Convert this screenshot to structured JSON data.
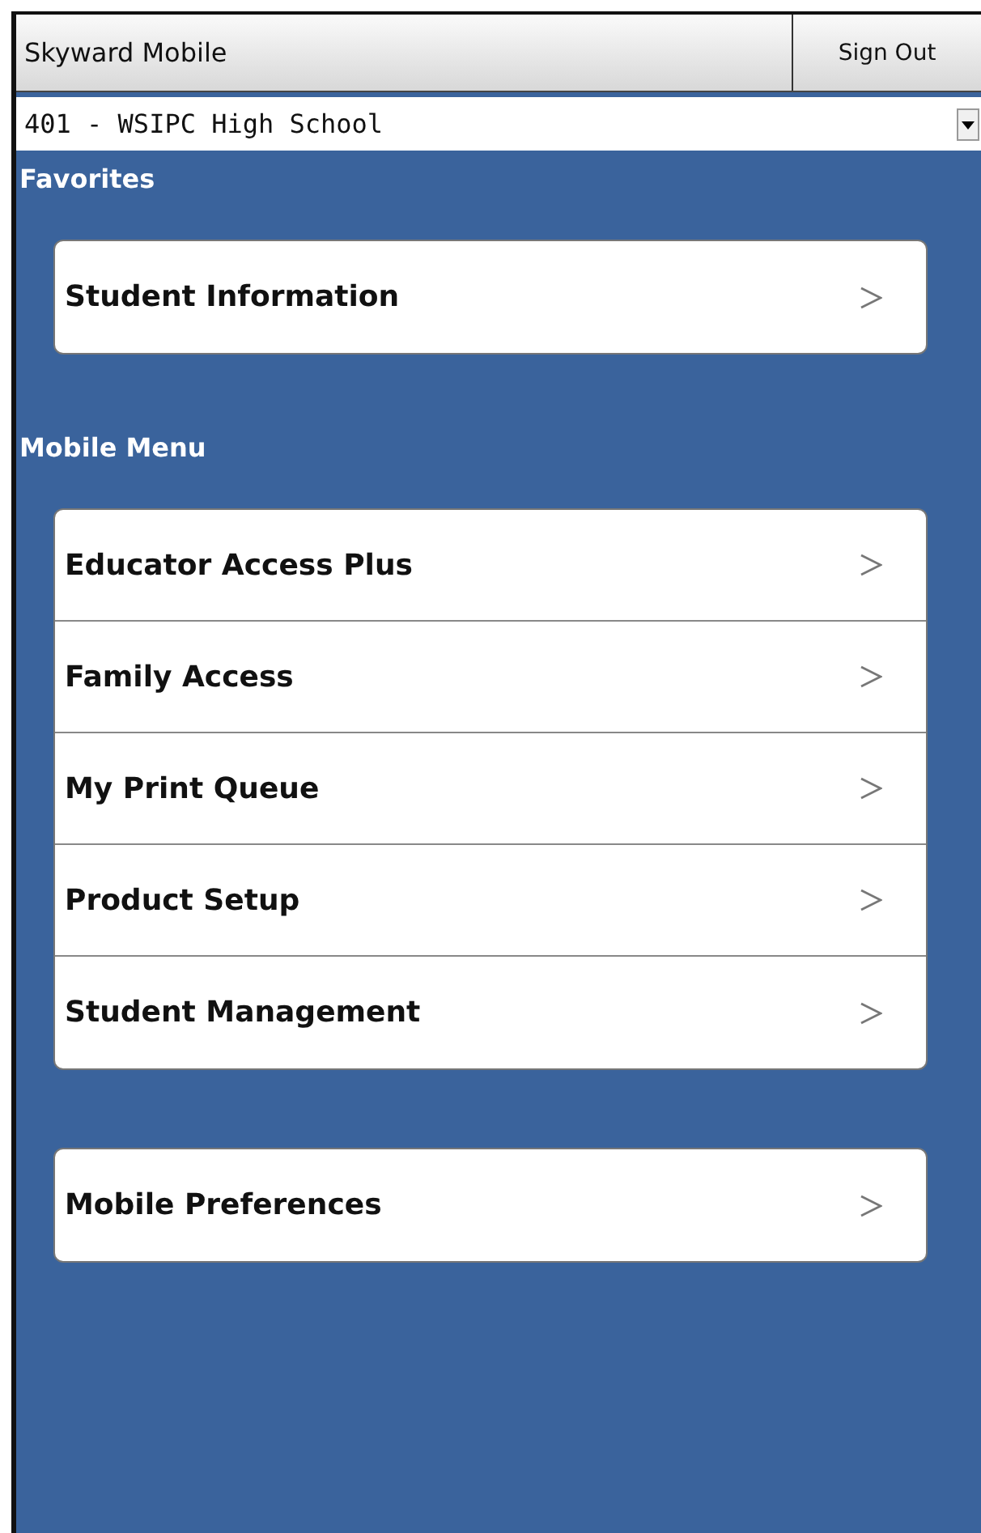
{
  "header": {
    "title": "Skyward Mobile",
    "sign_out": "Sign Out"
  },
  "school_select": {
    "value": "401 - WSIPC High School"
  },
  "sections": [
    {
      "heading": "Favorites",
      "groups": [
        [
          {
            "label": "Student Information"
          }
        ]
      ]
    },
    {
      "heading": "Mobile Menu",
      "groups": [
        [
          {
            "label": "Educator Access Plus"
          },
          {
            "label": "Family Access"
          },
          {
            "label": "My Print Queue"
          },
          {
            "label": "Product Setup"
          },
          {
            "label": "Student Management"
          }
        ],
        [
          {
            "label": "Mobile Preferences"
          }
        ]
      ]
    }
  ]
}
